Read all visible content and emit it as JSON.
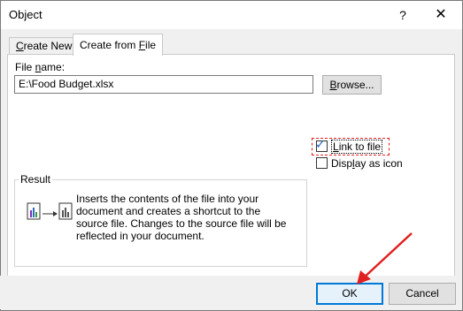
{
  "window": {
    "title": "Object",
    "help_glyph": "?",
    "close_glyph": "✕"
  },
  "tabs": [
    {
      "label": "Create New",
      "underline": "C",
      "rest": "reate New"
    },
    {
      "label": "Create from File",
      "prefix": "Create from ",
      "underline": "F",
      "rest": "ile"
    }
  ],
  "file": {
    "label_prefix": "File ",
    "label_underline": "n",
    "label_rest": "ame:",
    "value": "E:\\Food Budget.xlsx"
  },
  "browse": {
    "underline": "B",
    "rest": "rowse..."
  },
  "options": {
    "link_to_file": {
      "underline": "L",
      "rest": "ink to file",
      "checked": true
    },
    "display_as_icon": {
      "prefix": "Disp",
      "underline": "l",
      "rest": "ay as icon",
      "checked": false
    }
  },
  "result": {
    "legend": "Result",
    "text": "Inserts the contents of the file into your document and creates a shortcut to the source file.  Changes to the source file will be reflected in your document."
  },
  "buttons": {
    "ok": "OK",
    "cancel": "Cancel"
  },
  "colors": {
    "accent": "#0078d7",
    "highlight": "#e02020"
  }
}
